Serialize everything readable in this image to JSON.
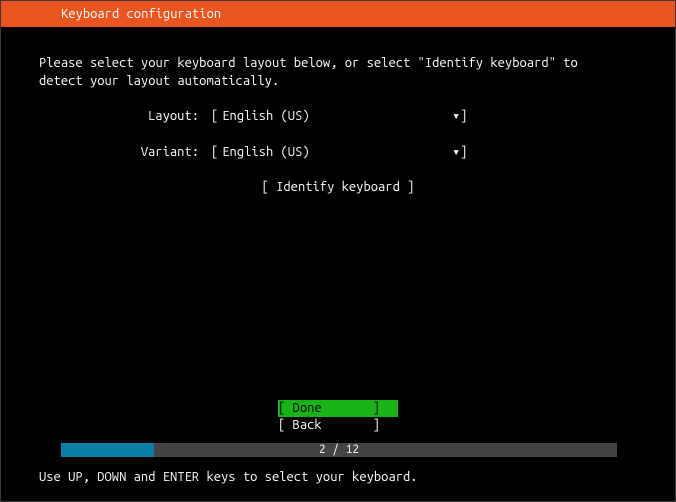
{
  "header": {
    "title": "Keyboard configuration"
  },
  "instructions": {
    "line1": "Please select your keyboard layout below, or select \"Identify keyboard\" to",
    "line2": "detect your layout automatically."
  },
  "form": {
    "layout_label": "Layout:",
    "layout_value": "English (US)",
    "variant_label": "Variant:",
    "variant_value": "English (US)",
    "dropdown_glyph": "▾",
    "identify_label": "[ Identify keyboard ]"
  },
  "buttons": {
    "done": "[ Done       ]",
    "back": "[ Back       ]"
  },
  "progress": {
    "text": "2 / 12",
    "percent": 16.7
  },
  "hint": "Use UP, DOWN and ENTER keys to select your keyboard."
}
